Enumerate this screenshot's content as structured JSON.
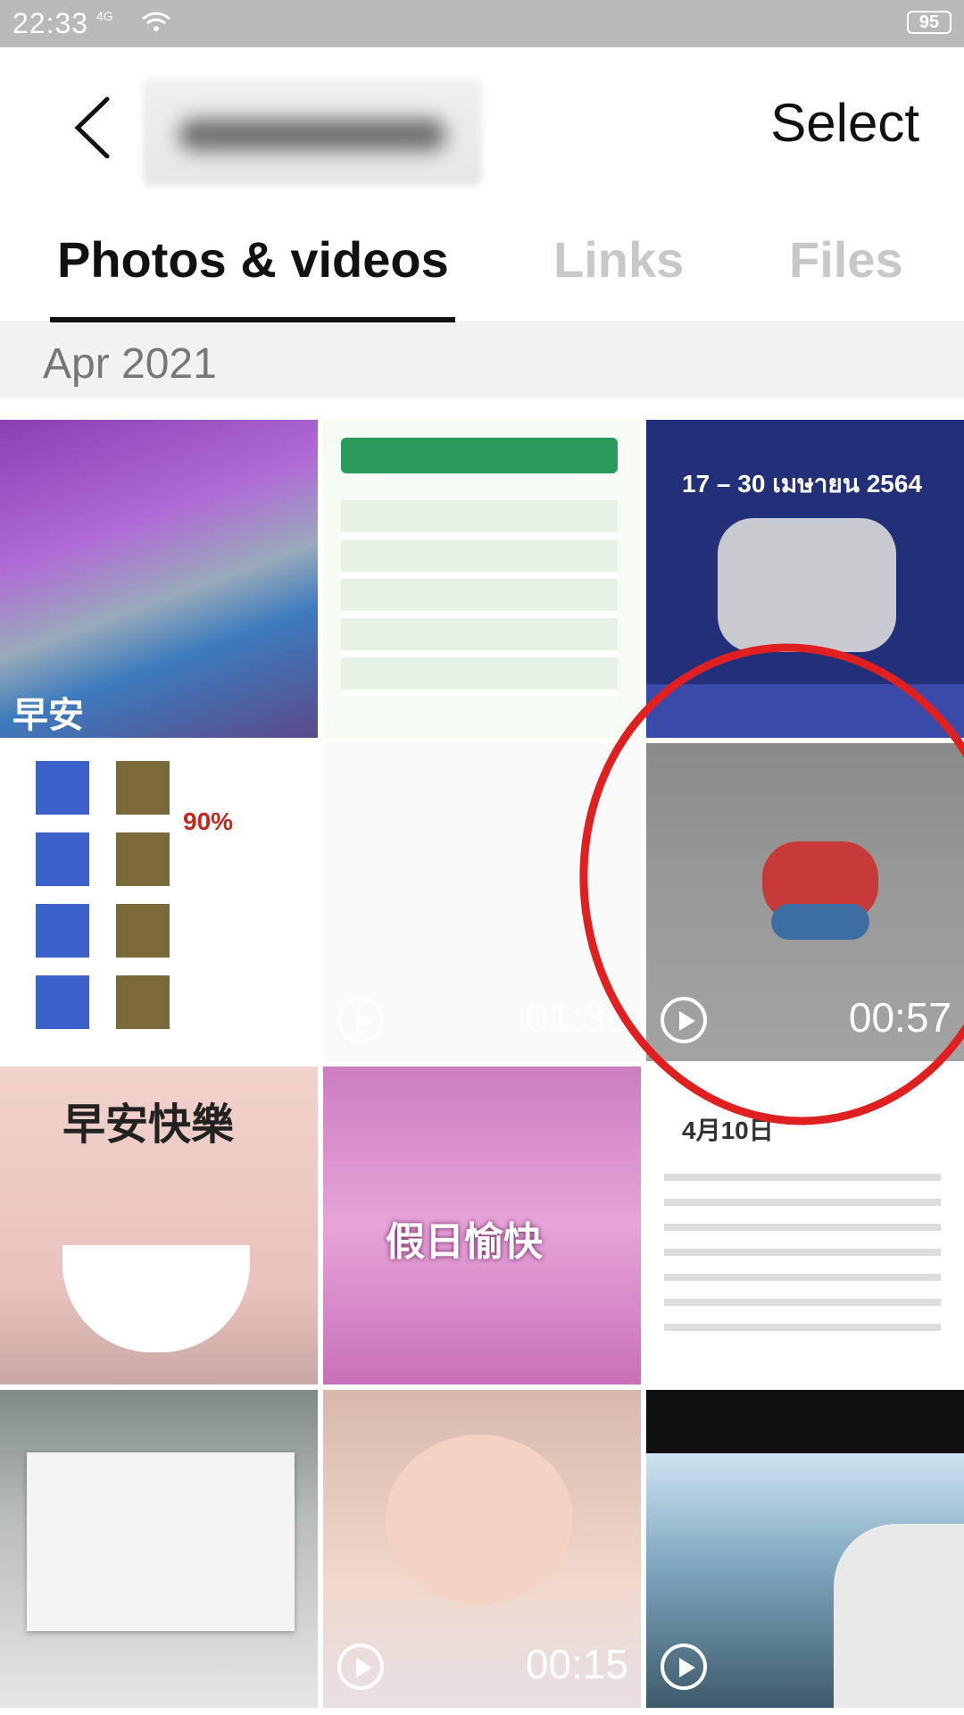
{
  "status_bar": {
    "time": "22:33",
    "network": "4G",
    "battery": "95"
  },
  "header": {
    "back_icon": "chevron-left-icon",
    "select_label": "Select"
  },
  "tabs": [
    {
      "label": "Photos & videos",
      "active": true
    },
    {
      "label": "Links",
      "active": false
    },
    {
      "label": "Files",
      "active": false
    }
  ],
  "section": {
    "date": "Apr 2021"
  },
  "media": [
    {
      "type": "photo",
      "overlay_text": "早安"
    },
    {
      "type": "photo",
      "overlay_text": ""
    },
    {
      "type": "photo",
      "overlay_text": "17 – 30 เมษายน 2564"
    },
    {
      "type": "video",
      "overlay_text": "90%",
      "duration": "01:38"
    },
    {
      "type": "video",
      "duration": "00:57"
    },
    {
      "type": "photo",
      "overlay_text": "早安快樂"
    },
    {
      "type": "photo",
      "overlay_text": "假日愉快"
    },
    {
      "type": "photo",
      "overlay_text": "4月10日"
    },
    {
      "type": "photo",
      "overlay_text": ""
    },
    {
      "type": "video",
      "duration": "00:15"
    },
    {
      "type": "video",
      "duration": ""
    }
  ],
  "colors": {
    "accent": "#111111",
    "inactive_tab": "#c8c8c8",
    "annotation": "#e02020"
  }
}
